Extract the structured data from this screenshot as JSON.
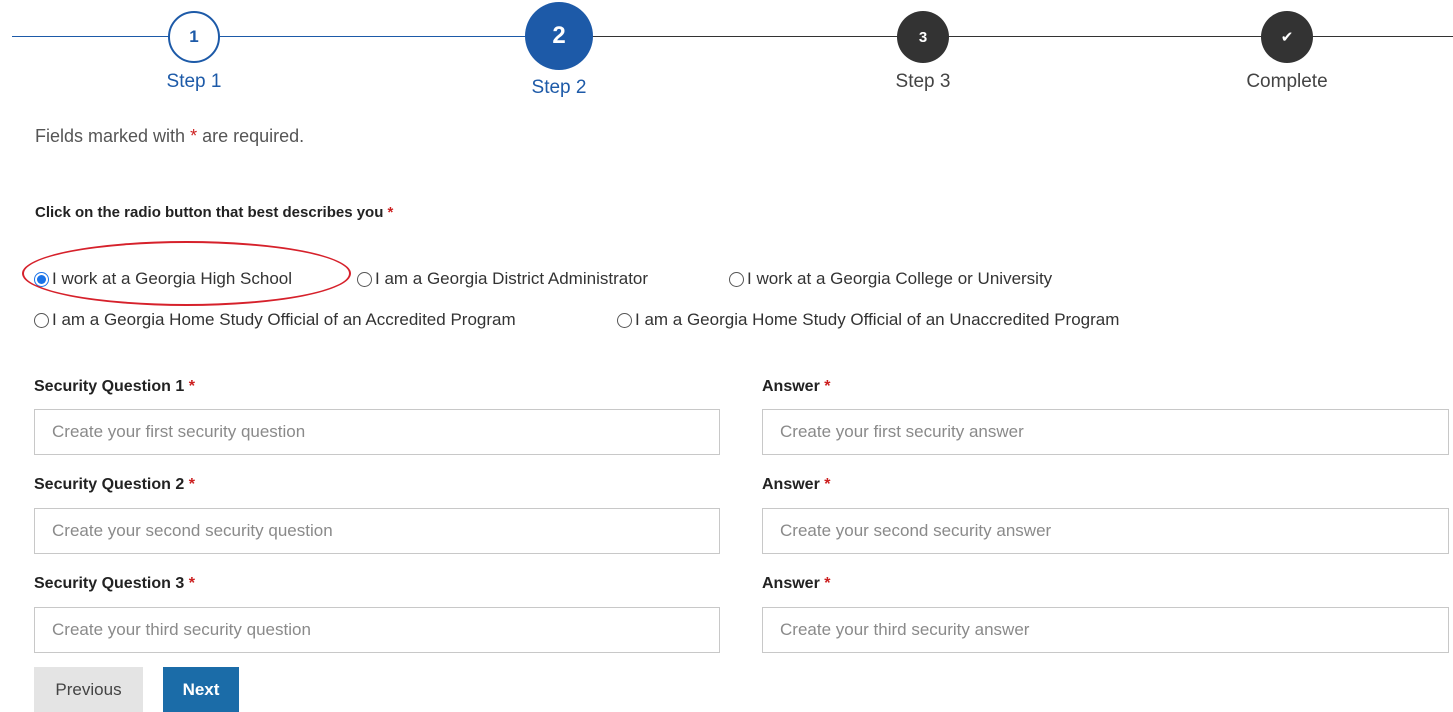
{
  "stepper": {
    "steps": [
      {
        "number": "1",
        "label": "Step 1"
      },
      {
        "number": "2",
        "label": "Step 2"
      },
      {
        "number": "3",
        "label": "Step 3"
      },
      {
        "number": "✔",
        "label": "Complete"
      }
    ],
    "active_step": "2"
  },
  "form": {
    "required_note_prefix": "Fields marked with ",
    "required_marker": "*",
    "required_note_suffix": " are required.",
    "radio_question": "Click on the radio button that best describes you ",
    "radio_options": [
      {
        "label": "I work at a Georgia High School",
        "selected": true
      },
      {
        "label": "I am a Georgia District Administrator",
        "selected": false
      },
      {
        "label": "I work at a Georgia College or University",
        "selected": false
      },
      {
        "label": "I am a Georgia Home Study Official of an Accredited Program",
        "selected": false
      },
      {
        "label": "I am a Georgia Home Study Official of an Unaccredited Program",
        "selected": false
      }
    ],
    "security": [
      {
        "question_label": "Security Question 1 ",
        "question_placeholder": "Create your first security question",
        "answer_label": "Answer  ",
        "answer_placeholder": "Create your first security answer"
      },
      {
        "question_label": "Security Question 2 ",
        "question_placeholder": "Create your second security question",
        "answer_label": "Answer  ",
        "answer_placeholder": "Create your second security answer"
      },
      {
        "question_label": "Security Question 3 ",
        "question_placeholder": "Create your third security question",
        "answer_label": "Answer  ",
        "answer_placeholder": "Create your third security answer"
      }
    ],
    "buttons": {
      "previous": "Previous",
      "next": "Next"
    }
  },
  "colors": {
    "primary": "#1d5aa8",
    "required": "#cc1f1f",
    "annotation": "#d6212b",
    "next_button": "#1b6ca8"
  }
}
